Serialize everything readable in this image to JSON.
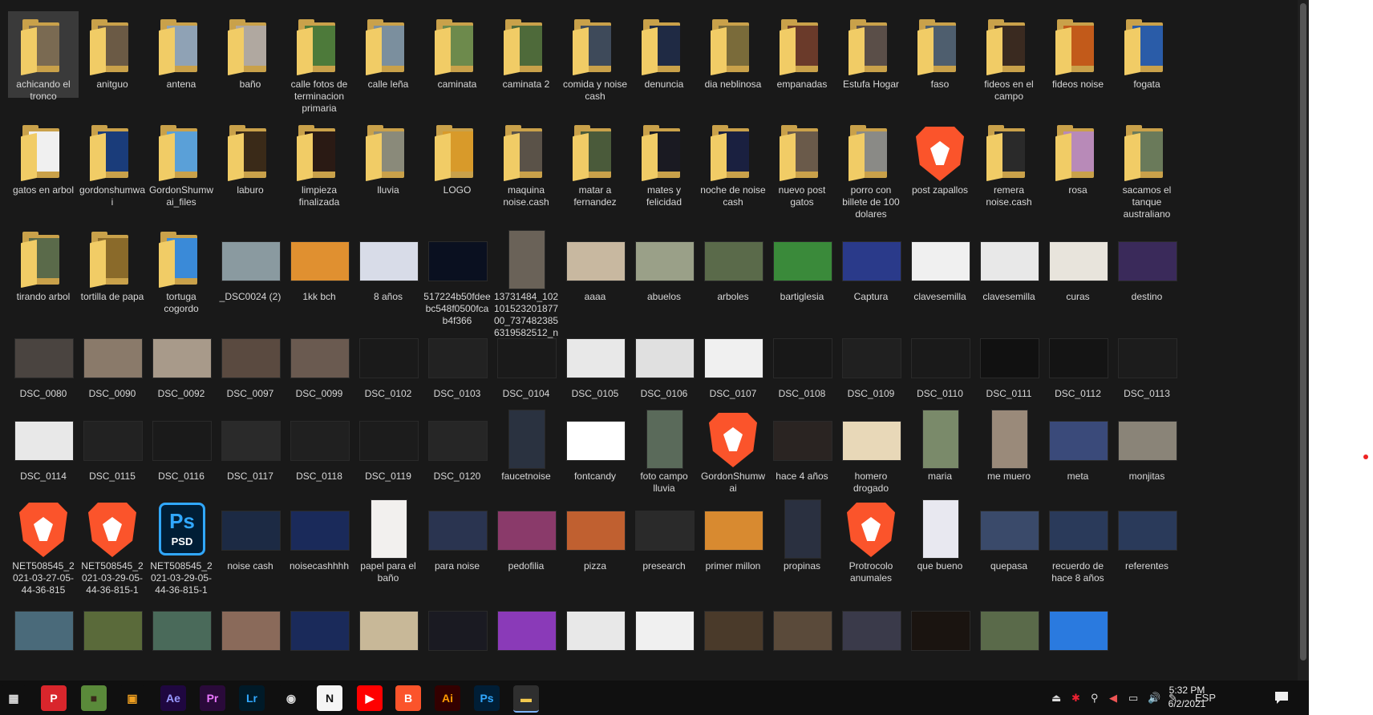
{
  "desktop": {
    "items": [
      {
        "label": "achicando el tronco",
        "kind": "folder",
        "thumb": "#7a6a52",
        "selected": true
      },
      {
        "label": "anitguo",
        "kind": "folder",
        "thumb": "#6b5a45"
      },
      {
        "label": "antena",
        "kind": "folder",
        "thumb": "#8fa2b5"
      },
      {
        "label": "baño",
        "kind": "folder",
        "thumb": "#b0a8a0"
      },
      {
        "label": "calle fotos de terminacion primaria",
        "kind": "folder",
        "thumb": "#4d7a3a"
      },
      {
        "label": "calle leña",
        "kind": "folder",
        "thumb": "#7b8f9e"
      },
      {
        "label": "caminata",
        "kind": "folder",
        "thumb": "#6d8a4c"
      },
      {
        "label": "caminata 2",
        "kind": "folder",
        "thumb": "#4e6a3a"
      },
      {
        "label": "comida y noise cash",
        "kind": "folder",
        "thumb": "#3e4a5a"
      },
      {
        "label": "denuncia",
        "kind": "folder",
        "thumb": "#1f2a44"
      },
      {
        "label": "dia neblinosa",
        "kind": "folder",
        "thumb": "#7a6b3a"
      },
      {
        "label": "empanadas",
        "kind": "folder",
        "thumb": "#6a3a2a"
      },
      {
        "label": "Estufa Hogar",
        "kind": "folder",
        "thumb": "#5a4e48"
      },
      {
        "label": "faso",
        "kind": "folder",
        "thumb": "#4e5e6e"
      },
      {
        "label": "fideos en el campo",
        "kind": "folder",
        "thumb": "#3a2a20"
      },
      {
        "label": "fideos noise",
        "kind": "folder",
        "thumb": "#c25a1a"
      },
      {
        "label": "fogata",
        "kind": "folder",
        "thumb": "#2a5ca8"
      },
      {
        "label": "gatos en arbol",
        "kind": "folder",
        "thumb": "#f0f0f0"
      },
      {
        "label": "gordonshumwai",
        "kind": "folder",
        "thumb": "#1a3c7a"
      },
      {
        "label": "GordonShumwai_files",
        "kind": "folder",
        "thumb": "#5aa0d8"
      },
      {
        "label": "laburo",
        "kind": "folder",
        "thumb": "#3a2a18"
      },
      {
        "label": "limpieza finalizada",
        "kind": "folder",
        "thumb": "#2a1a14"
      },
      {
        "label": "lluvia",
        "kind": "folder",
        "thumb": "#8a8a7a"
      },
      {
        "label": "LOGO",
        "kind": "folder",
        "thumb": "#d89a2a"
      },
      {
        "label": "maquina noise.cash",
        "kind": "folder",
        "thumb": "#5a5248"
      },
      {
        "label": "matar a fernandez",
        "kind": "folder",
        "thumb": "#4a5a3a"
      },
      {
        "label": "mates y felicidad",
        "kind": "folder",
        "thumb": "#1a1a22"
      },
      {
        "label": "noche de noise cash",
        "kind": "folder",
        "thumb": "#1a2040"
      },
      {
        "label": "nuevo post gatos",
        "kind": "folder",
        "thumb": "#6a5a4a"
      },
      {
        "label": "porro con billete de 100 dolares",
        "kind": "folder",
        "thumb": "#8a8a86"
      },
      {
        "label": "post zapallos",
        "kind": "brave"
      },
      {
        "label": "remera noise.cash",
        "kind": "folder",
        "thumb": "#2a2a2a"
      },
      {
        "label": "rosa",
        "kind": "folder",
        "thumb": "#b88ab8"
      },
      {
        "label": "sacamos el tanque australiano",
        "kind": "folder",
        "thumb": "#6a7a5a"
      },
      {
        "label": "tirando arbol",
        "kind": "folder",
        "thumb": "#5a6a4a"
      },
      {
        "label": "tortilla de papa",
        "kind": "folder",
        "thumb": "#8a6a2a"
      },
      {
        "label": "tortuga cogordo",
        "kind": "folder",
        "thumb": "#3a8ad8"
      },
      {
        "label": "_DSC0024 (2)",
        "kind": "photo",
        "thumb": "#8a9aa0"
      },
      {
        "label": "1kk bch",
        "kind": "photo",
        "thumb": "#e09030"
      },
      {
        "label": "8 años",
        "kind": "photo",
        "thumb": "#d8dce8"
      },
      {
        "label": "517224b50fdeebc548f0500fcab4f366",
        "kind": "photo",
        "thumb": "#0a1020"
      },
      {
        "label": "13731484_10210152320187700_7374823856319582512_n",
        "kind": "photo-tall",
        "thumb": "#6a6258"
      },
      {
        "label": "aaaa",
        "kind": "photo",
        "thumb": "#c8b8a0"
      },
      {
        "label": "abuelos",
        "kind": "photo",
        "thumb": "#9aa088"
      },
      {
        "label": "arboles",
        "kind": "photo",
        "thumb": "#5a6a4a"
      },
      {
        "label": "bartiglesia",
        "kind": "photo",
        "thumb": "#3a8a3a"
      },
      {
        "label": "Captura",
        "kind": "photo",
        "thumb": "#2a3a8a"
      },
      {
        "label": "clavesemilla",
        "kind": "photo",
        "thumb": "#f0f0f0"
      },
      {
        "label": "clavesemilla",
        "kind": "photo",
        "thumb": "#e8e8e8"
      },
      {
        "label": "curas",
        "kind": "photo",
        "thumb": "#e8e4dc"
      },
      {
        "label": "destino",
        "kind": "photo",
        "thumb": "#3a2a5a"
      },
      {
        "label": "DSC_0080",
        "kind": "photo",
        "thumb": "#4a4440"
      },
      {
        "label": "DSC_0090",
        "kind": "photo",
        "thumb": "#8a7a6a"
      },
      {
        "label": "DSC_0092",
        "kind": "photo",
        "thumb": "#a89a8a"
      },
      {
        "label": "DSC_0097",
        "kind": "photo",
        "thumb": "#5a4a40"
      },
      {
        "label": "DSC_0099",
        "kind": "photo",
        "thumb": "#6a5a50"
      },
      {
        "label": "DSC_0102",
        "kind": "photo",
        "thumb": "#1a1a1a"
      },
      {
        "label": "DSC_0103",
        "kind": "photo",
        "thumb": "#222222"
      },
      {
        "label": "DSC_0104",
        "kind": "photo",
        "thumb": "#1a1a1a"
      },
      {
        "label": "DSC_0105",
        "kind": "photo",
        "thumb": "#e8e8e8"
      },
      {
        "label": "DSC_0106",
        "kind": "photo",
        "thumb": "#e0e0e0"
      },
      {
        "label": "DSC_0107",
        "kind": "photo",
        "thumb": "#f0f0f0"
      },
      {
        "label": "DSC_0108",
        "kind": "photo",
        "thumb": "#181818"
      },
      {
        "label": "DSC_0109",
        "kind": "photo",
        "thumb": "#202020"
      },
      {
        "label": "DSC_0110",
        "kind": "photo",
        "thumb": "#1a1a1a"
      },
      {
        "label": "DSC_0111",
        "kind": "photo",
        "thumb": "#111111"
      },
      {
        "label": "DSC_0112",
        "kind": "photo",
        "thumb": "#141414"
      },
      {
        "label": "DSC_0113",
        "kind": "photo",
        "thumb": "#1c1c1c"
      },
      {
        "label": "DSC_0114",
        "kind": "photo",
        "thumb": "#e8e8e8"
      },
      {
        "label": "DSC_0115",
        "kind": "photo",
        "thumb": "#222222"
      },
      {
        "label": "DSC_0116",
        "kind": "photo",
        "thumb": "#1a1a1a"
      },
      {
        "label": "DSC_0117",
        "kind": "photo",
        "thumb": "#2a2a2a"
      },
      {
        "label": "DSC_0118",
        "kind": "photo",
        "thumb": "#202020"
      },
      {
        "label": "DSC_0119",
        "kind": "photo",
        "thumb": "#1c1c1c"
      },
      {
        "label": "DSC_0120",
        "kind": "photo",
        "thumb": "#262626"
      },
      {
        "label": "faucetnoise",
        "kind": "photo-tall",
        "thumb": "#2a3240"
      },
      {
        "label": "fontcandy",
        "kind": "photo",
        "thumb": "#ffffff"
      },
      {
        "label": "foto campo lluvia",
        "kind": "photo-tall",
        "thumb": "#5a6a5a"
      },
      {
        "label": "GordonShumwai",
        "kind": "brave"
      },
      {
        "label": "hace 4 años",
        "kind": "photo",
        "thumb": "#2a2422"
      },
      {
        "label": "homero drogado",
        "kind": "photo",
        "thumb": "#e8d8b8"
      },
      {
        "label": "maria",
        "kind": "photo-tall",
        "thumb": "#7a8a6a"
      },
      {
        "label": "me muero",
        "kind": "photo-tall",
        "thumb": "#9a8a7a"
      },
      {
        "label": "meta",
        "kind": "photo",
        "thumb": "#3a4a7a"
      },
      {
        "label": "monjitas",
        "kind": "photo",
        "thumb": "#8a8478"
      },
      {
        "label": "NET508545_2021-03-27-05-44-36-815",
        "kind": "brave"
      },
      {
        "label": "NET508545_2021-03-29-05-44-36-815-1",
        "kind": "brave"
      },
      {
        "label": "NET508545_2021-03-29-05-44-36-815-1",
        "kind": "ps"
      },
      {
        "label": "noise cash",
        "kind": "photo",
        "thumb": "#1c2a44"
      },
      {
        "label": "noisecashhhh",
        "kind": "photo",
        "thumb": "#1a2a5a"
      },
      {
        "label": "papel para el baño",
        "kind": "photo-tall",
        "thumb": "#f2f0ee"
      },
      {
        "label": "para noise",
        "kind": "photo",
        "thumb": "#2a3450"
      },
      {
        "label": "pedofilia",
        "kind": "photo",
        "thumb": "#8a3a6a"
      },
      {
        "label": "pizza",
        "kind": "photo",
        "thumb": "#c06030"
      },
      {
        "label": "presearch",
        "kind": "photo",
        "thumb": "#2a2a2a"
      },
      {
        "label": "primer millon",
        "kind": "photo",
        "thumb": "#d88a30"
      },
      {
        "label": "propinas",
        "kind": "photo-tall",
        "thumb": "#2a3040"
      },
      {
        "label": "Protrocolo anumales",
        "kind": "brave"
      },
      {
        "label": "que bueno",
        "kind": "photo-tall",
        "thumb": "#e8e8f0"
      },
      {
        "label": "quepasa",
        "kind": "photo",
        "thumb": "#3a4a6a"
      },
      {
        "label": "recuerdo de hace 8 años",
        "kind": "photo",
        "thumb": "#2a3a5a"
      },
      {
        "label": "referentes",
        "kind": "photo",
        "thumb": "#2a3a5a"
      }
    ],
    "row8": [
      {
        "thumb": "#4a6a7a"
      },
      {
        "thumb": "#5a6a3a"
      },
      {
        "thumb": "#4a6a5a"
      },
      {
        "thumb": "#8a6a5a"
      },
      {
        "thumb": "#1a2a5a"
      },
      {
        "thumb": "#c8b898"
      },
      {
        "thumb": "#1a1a22"
      },
      {
        "thumb": "#8a3ab8"
      },
      {
        "thumb": "#e8e8e8"
      },
      {
        "thumb": "#f0f0f0"
      },
      {
        "thumb": "#4a3a2a"
      },
      {
        "thumb": "#5a4a3a"
      },
      {
        "thumb": "#3a3a4a"
      },
      {
        "thumb": "#1a1410"
      },
      {
        "thumb": "#5a6a4a"
      },
      {
        "thumb": "#2a7adf"
      }
    ]
  },
  "taskbar": {
    "apps": [
      {
        "name": "calculator-icon",
        "glyph": "▦",
        "bg": "#101010",
        "fg": "#ddd"
      },
      {
        "name": "presearch-icon",
        "glyph": "P",
        "bg": "#d9262c",
        "fg": "#fff"
      },
      {
        "name": "minecraft-icon",
        "glyph": "■",
        "bg": "#5a8a3a",
        "fg": "#3a2a1a"
      },
      {
        "name": "store-icon",
        "glyph": "▣",
        "bg": "#101010",
        "fg": "#f0a020"
      },
      {
        "name": "after-effects-icon",
        "glyph": "Ae",
        "bg": "#1f0740",
        "fg": "#9999ff"
      },
      {
        "name": "premiere-icon",
        "glyph": "Pr",
        "bg": "#2a0a3a",
        "fg": "#ea77ff"
      },
      {
        "name": "lightroom-icon",
        "glyph": "Lr",
        "bg": "#001a28",
        "fg": "#31a8ff"
      },
      {
        "name": "obs-icon",
        "glyph": "◉",
        "bg": "#101010",
        "fg": "#ddd"
      },
      {
        "name": "notion-icon",
        "glyph": "N",
        "bg": "#f5f5f5",
        "fg": "#111"
      },
      {
        "name": "youtube-icon",
        "glyph": "▶",
        "bg": "#ff0000",
        "fg": "#fff"
      },
      {
        "name": "brave-icon",
        "glyph": "B",
        "bg": "#fb542b",
        "fg": "#fff"
      },
      {
        "name": "illustrator-icon",
        "glyph": "Ai",
        "bg": "#330000",
        "fg": "#ff9a00"
      },
      {
        "name": "photoshop-icon",
        "glyph": "Ps",
        "bg": "#001e36",
        "fg": "#31a8ff"
      },
      {
        "name": "file-explorer-icon",
        "glyph": "▬",
        "bg": "#2f2f2f",
        "fg": "#f3c94e",
        "active": true
      }
    ],
    "tray": {
      "language": "ESP",
      "time": "5:32 PM",
      "date": "6/2/2021"
    }
  }
}
